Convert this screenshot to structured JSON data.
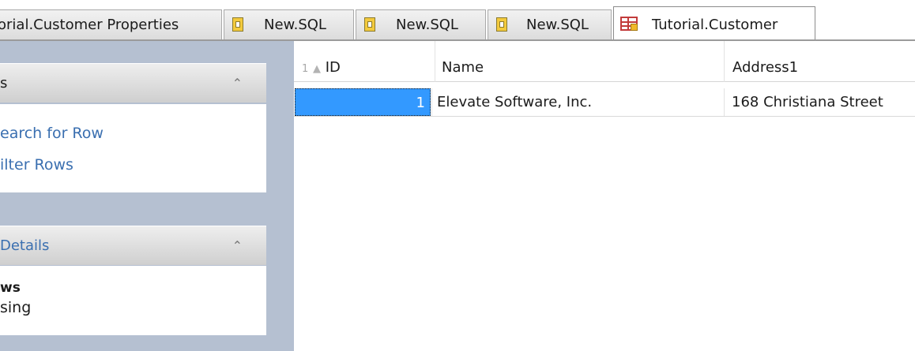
{
  "tabs": [
    {
      "label": "orial.Customer Properties",
      "icon": "none",
      "active": false
    },
    {
      "label": "New.SQL",
      "icon": "sql-file-icon",
      "active": false
    },
    {
      "label": "New.SQL",
      "icon": "sql-file-icon",
      "active": false
    },
    {
      "label": "New.SQL",
      "icon": "sql-file-icon",
      "active": false
    },
    {
      "label": "Tutorial.Customer",
      "icon": "table-icon",
      "active": true
    }
  ],
  "sidebar": {
    "group1": {
      "title": "s",
      "collapse_glyph": "⌃",
      "links": [
        "earch for Row",
        "ilter Rows"
      ]
    },
    "group2": {
      "title": "Details",
      "collapse_glyph": "⌃",
      "line1": "ws",
      "line2": "sing"
    }
  },
  "grid": {
    "row_indicator": "1",
    "sort_glyph": "▲",
    "columns": [
      "ID",
      "Name",
      "Address1"
    ],
    "rows": [
      {
        "id": "1",
        "name": "Elevate Software, Inc.",
        "address1": "168 Christiana Street"
      }
    ]
  }
}
